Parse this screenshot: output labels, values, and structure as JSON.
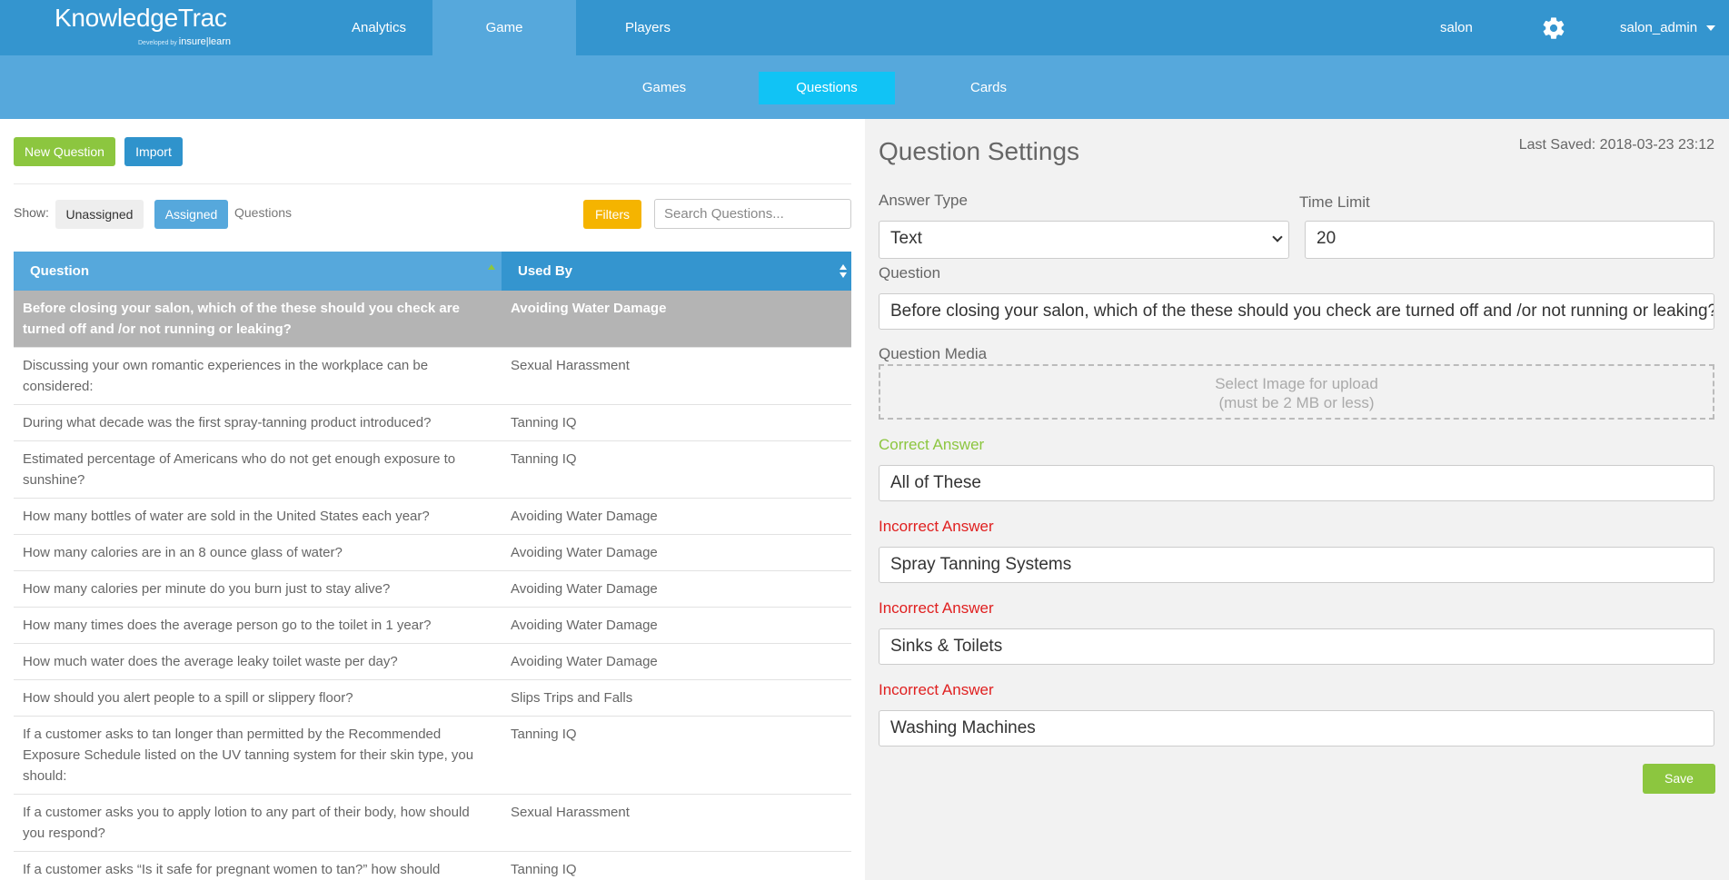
{
  "brand": {
    "name": "KnowledgeTrac",
    "developed_by": "Developed by",
    "partner": "insure|learn"
  },
  "top_nav": {
    "items": [
      "Analytics",
      "Game",
      "Players"
    ],
    "active": "Game"
  },
  "account": {
    "site": "salon",
    "user": "salon_admin",
    "settings_icon": "gear-icon"
  },
  "sub_nav": {
    "items": [
      "Games",
      "Questions",
      "Cards"
    ],
    "active": "Questions"
  },
  "toolbar": {
    "new_question": "New Question",
    "import": "Import"
  },
  "filter_bar": {
    "show_label": "Show:",
    "unassigned": "Unassigned",
    "assigned": "Assigned",
    "questions_label": "Questions",
    "filters": "Filters",
    "search_placeholder": "Search Questions..."
  },
  "table": {
    "headers": {
      "question": "Question",
      "used_by": "Used By"
    },
    "rows": [
      {
        "question": "Before closing your salon, which of the these should you check are turned off and /or not running or leaking?",
        "used_by": "Avoiding Water Damage",
        "selected": true
      },
      {
        "question": "Discussing your own romantic experiences in the workplace can be considered:",
        "used_by": "Sexual Harassment"
      },
      {
        "question": "During what decade was the first spray-tanning product introduced?",
        "used_by": "Tanning IQ"
      },
      {
        "question": "Estimated percentage of Americans who do not get enough exposure to sunshine?",
        "used_by": "Tanning IQ"
      },
      {
        "question": "How many bottles of water are sold in the United States each year?",
        "used_by": "Avoiding Water Damage"
      },
      {
        "question": "How many calories are in an 8 ounce glass of water?",
        "used_by": "Avoiding Water Damage"
      },
      {
        "question": "How many calories per minute do you burn just to stay alive?",
        "used_by": "Avoiding Water Damage"
      },
      {
        "question": "How many times does the average person go to the toilet in 1 year?",
        "used_by": "Avoiding Water Damage"
      },
      {
        "question": "How much water does the average leaky toilet waste per day?",
        "used_by": "Avoiding Water Damage"
      },
      {
        "question": "How should you alert people to a spill or slippery floor?",
        "used_by": "Slips Trips and Falls"
      },
      {
        "question": "If a customer asks to tan longer than permitted by the Recommended Exposure Schedule listed on the UV tanning system for their skin type, you should:",
        "used_by": "Tanning IQ"
      },
      {
        "question": "If a customer asks you to apply lotion to any part of their body, how should you respond?",
        "used_by": "Sexual Harassment"
      },
      {
        "question": "If a customer asks “Is it safe for pregnant women to tan?” how should",
        "used_by": "Tanning IQ"
      }
    ]
  },
  "settings": {
    "title": "Question Settings",
    "last_saved": "Last Saved: 2018-03-23 23:12",
    "answer_type_label": "Answer Type",
    "answer_type_value": "Text",
    "time_limit_label": "Time Limit",
    "time_limit_value": "20",
    "question_label": "Question",
    "question_value": "Before closing your salon, which of the these should you check are turned off and /or not running or leaking?",
    "media_label": "Question Media",
    "media_line1": "Select Image for upload",
    "media_line2": "(must be 2 MB or less)",
    "correct_label": "Correct Answer",
    "correct_value": "All of These",
    "incorrect_label": "Incorrect Answer",
    "incorrect_values": [
      "Spray Tanning Systems",
      "Sinks & Toilets",
      "Washing Machines"
    ],
    "save": "Save"
  },
  "colors": {
    "primary": "#3495cf",
    "secondary": "#56a8dc",
    "accent": "#11c3f5",
    "green": "#8cc63f",
    "orange": "#f5b400",
    "red": "#e02020"
  }
}
